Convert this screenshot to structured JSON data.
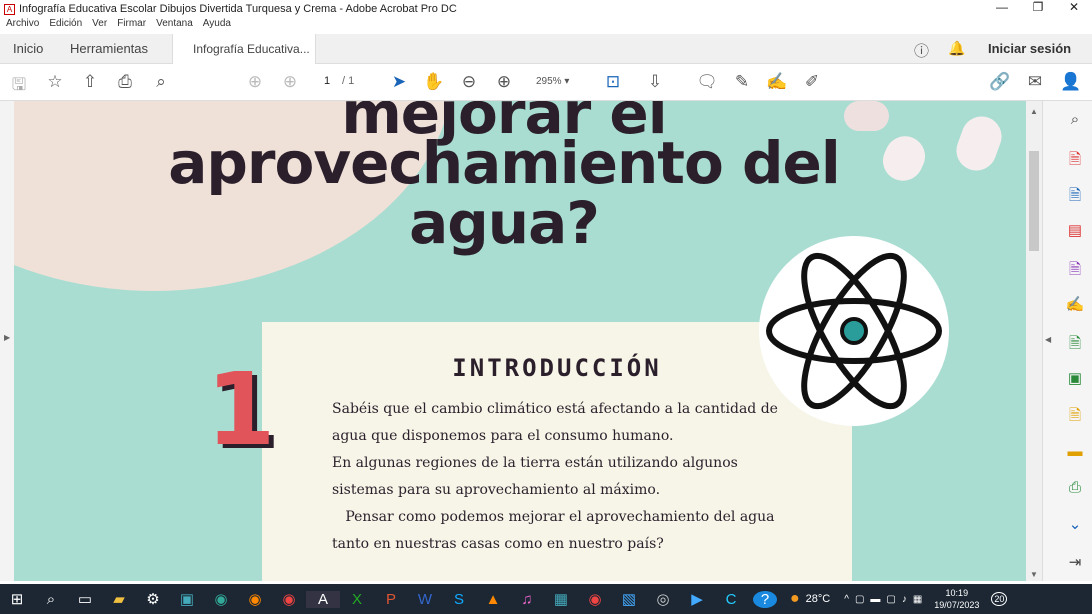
{
  "window": {
    "title": "Infografía Educativa Escolar Dibujos Divertida Turquesa y Crema - Adobe Acrobat Pro DC"
  },
  "menu": [
    "Archivo",
    "Edición",
    "Ver",
    "Firmar",
    "Ventana",
    "Ayuda"
  ],
  "tabs": {
    "home": "Inicio",
    "tools": "Herramientas",
    "doc": "Infografía Educativa..."
  },
  "header": {
    "signin": "Iniciar sesión"
  },
  "toolbar": {
    "page": "1",
    "page_total": "/ 1",
    "zoom": "295%"
  },
  "document": {
    "title_line1": "mejorar el",
    "title_line2": "aprovechamiento del",
    "title_line3": "agua?",
    "number": "1",
    "section_title": "INTRODUCCIÓN",
    "paragraph1": "Sabéis que el cambio climático está afectando a la cantidad de agua que disponemos para el consumo humano.",
    "paragraph2": "En algunas regiones de la tierra están utilizando algunos sistemas para su aprovechamiento al máximo.",
    "paragraph3": "Pensar como podemos mejorar el aprovechamiento del agua tanto en nuestras casas como en nuestro país?"
  },
  "taskbar": {
    "weather": "28°C",
    "time": "10:19",
    "date": "19/07/2023",
    "notifications": "20"
  },
  "colors": {
    "page_bg": "#a9ddd1",
    "card": "#f6f5e7",
    "accent": "#e0545a",
    "text": "#2a1f2b"
  }
}
